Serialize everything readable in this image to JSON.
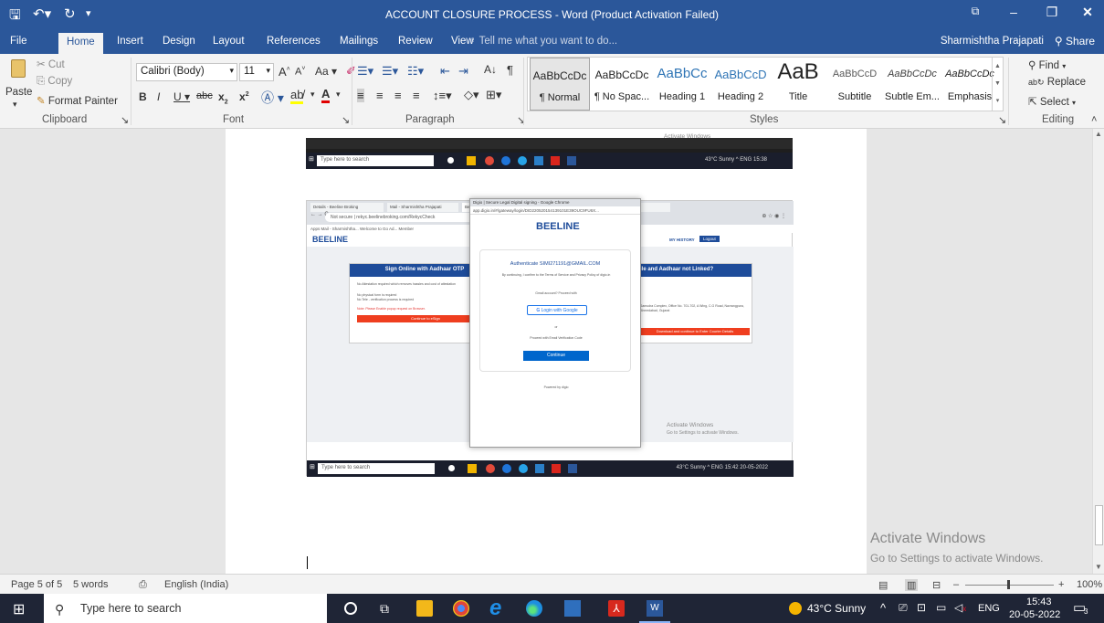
{
  "window": {
    "title": "ACCOUNT CLOSURE PROCESS - Word (Product Activation Failed)",
    "user": "Sharmishtha Prajapati",
    "share_label": "Share"
  },
  "tabs": [
    "File",
    "Home",
    "Insert",
    "Design",
    "Layout",
    "References",
    "Mailings",
    "Review",
    "View"
  ],
  "tell_me": "Tell me what you want to do...",
  "clipboard": {
    "paste": "Paste",
    "cut": "Cut",
    "copy": "Copy",
    "format_painter": "Format Painter",
    "label": "Clipboard"
  },
  "font": {
    "family": "Calibri (Body)",
    "size": "11",
    "label": "Font"
  },
  "paragraph": {
    "label": "Paragraph"
  },
  "styles": {
    "label": "Styles",
    "items": [
      {
        "preview": "AaBbCcDc",
        "name": "¶ Normal"
      },
      {
        "preview": "AaBbCcDc",
        "name": "¶ No Spac..."
      },
      {
        "preview": "AaBbCc",
        "name": "Heading 1"
      },
      {
        "preview": "AaBbCcD",
        "name": "Heading 2"
      },
      {
        "preview": "AaB",
        "name": "Title"
      },
      {
        "preview": "AaBbCcD",
        "name": "Subtitle"
      },
      {
        "preview": "AaBbCcDc",
        "name": "Subtle Em..."
      },
      {
        "preview": "AaBbCcDc",
        "name": "Emphasis"
      }
    ]
  },
  "editing": {
    "find": "Find",
    "replace": "Replace",
    "select": "Select",
    "label": "Editing"
  },
  "activation": {
    "title": "Activate Windows",
    "subtitle": "Go to Settings to activate Windows."
  },
  "embedded": {
    "search_placeholder": "Type here to search",
    "tray_weather": "43°C Sunny",
    "tray_lang": "ENG",
    "time1": "15:38",
    "time2": "15:42",
    "date": "20-05-2022",
    "tabs": [
      "Details - Beeline Broking",
      "Mail - Sharmishtha Prajapati",
      "Beelinebroking",
      "Client KRDC - Beeline Broki",
      "Settings"
    ],
    "url": "rekyc.beelinebroking.com/RekycCheck",
    "not_secure": "Not secure",
    "bookmarks": "Apps   Mail - Sharmishtha...   Welcome to Go Ad...   Member",
    "brand": "BEELINE",
    "my_history": "MY HISTORY",
    "logout": "Logout",
    "left_card": {
      "title": "Sign Online with Aadhaar OTP",
      "b1": "No Attestation required which removes hassles and cost of attestation",
      "b2": "No physical form is required",
      "b3": "No Tele - verification process is required",
      "note": "Note: Please Enable popup request on Browser.",
      "button": "Continue to eSign"
    },
    "right_card": {
      "title": "ile and Aadhaar not Linked?",
      "address": "Samudra Complex, Office No. 701-702, A Wing, C.G Road, Navrangpura, Ahmedabad, Gujarat",
      "button": "Download and continue to Enter Courier Details"
    },
    "popup": {
      "title": "Digio | Secure Legal Digital signing - Google Chrome",
      "url": "app.digio.in/#/gateway/login/DID220520154139101E39OUC9FU6X...",
      "brand": "BEELINE",
      "authenticate": "Authenticate SIMI271191@GMAIL.COM",
      "consent": "By continuing, I confirm to the Terms of Service and Privacy Policy of digio.in",
      "gmail": "Gmail account? Proceed with",
      "google_button": "Login with Google",
      "or": "or",
      "email_code": "Proceed with Email Verification Code",
      "continue": "Continue",
      "powered": "Powered by digio"
    }
  },
  "status": {
    "page": "Page 5 of 5",
    "words": "5 words",
    "language": "English (India)",
    "zoom": "100%"
  },
  "taskbar": {
    "search_placeholder": "Type here to search",
    "weather": "43°C Sunny",
    "lang": "ENG",
    "time": "15:43",
    "date": "20-05-2022",
    "notif_count": "3"
  }
}
